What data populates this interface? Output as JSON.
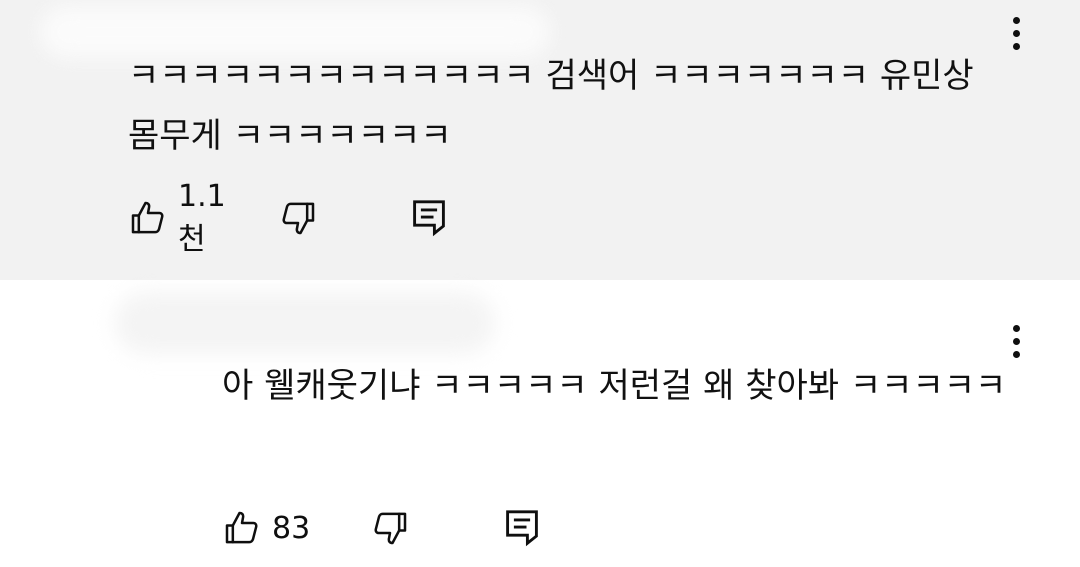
{
  "comments": [
    {
      "text": "ㅋㅋㅋㅋㅋㅋㅋㅋㅋㅋㅋㅋㅋ 검색어 ㅋㅋㅋㅋㅋㅋㅋ 유민상 몸무게 ㅋㅋㅋㅋㅋㅋㅋ",
      "likes": "1.1천",
      "icons": {
        "like": "thumbs-up-icon",
        "dislike": "thumbs-down-icon",
        "reply": "reply-icon",
        "more": "more-vert-icon"
      }
    },
    {
      "text": "아 웰캐웃기냐 ㅋㅋㅋㅋㅋ 저런걸 왜 찾아봐 ㅋㅋㅋㅋㅋ",
      "likes": "83",
      "icons": {
        "like": "thumbs-up-icon",
        "dislike": "thumbs-down-icon",
        "reply": "reply-icon",
        "more": "more-vert-icon"
      }
    }
  ],
  "colors": {
    "highlighted_background": "#f2f2f2",
    "background": "#ffffff",
    "text": "#0f0f0f"
  }
}
